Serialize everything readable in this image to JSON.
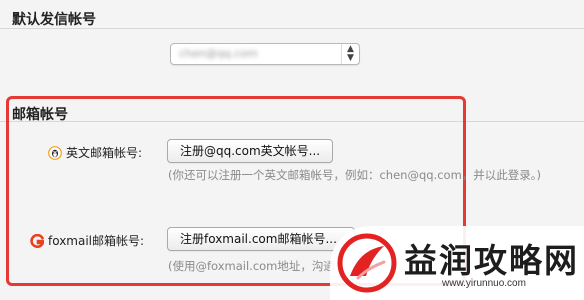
{
  "default_sender": {
    "title": "默认发信帐号",
    "selected_value": "chen@qq.com"
  },
  "mailbox_accounts": {
    "title": "邮箱帐号",
    "english_account": {
      "label": "英文邮箱帐号:",
      "button_label": "注册@qq.com英文帐号...",
      "hint": "(你还可以注册一个英文邮箱帐号，例如：chen@qq.com，并以此登录。)"
    },
    "foxmail_account": {
      "label": "foxmail邮箱帐号:",
      "button_label": "注册foxmail.com邮箱帐号...",
      "hint": "(使用@foxmail.com地址，沟通"
    }
  },
  "watermark": {
    "text": "益润攻略网",
    "url": "www.yirunnuo.com"
  },
  "colors": {
    "highlight_border": "#e53935",
    "foxmail_brand": "#e8431c",
    "watermark_red": "#e32222"
  },
  "icons": {
    "english_account": "qq-penguin-icon",
    "foxmail_account": "foxmail-logo-icon",
    "select_arrows": "updown-arrows-icon"
  }
}
